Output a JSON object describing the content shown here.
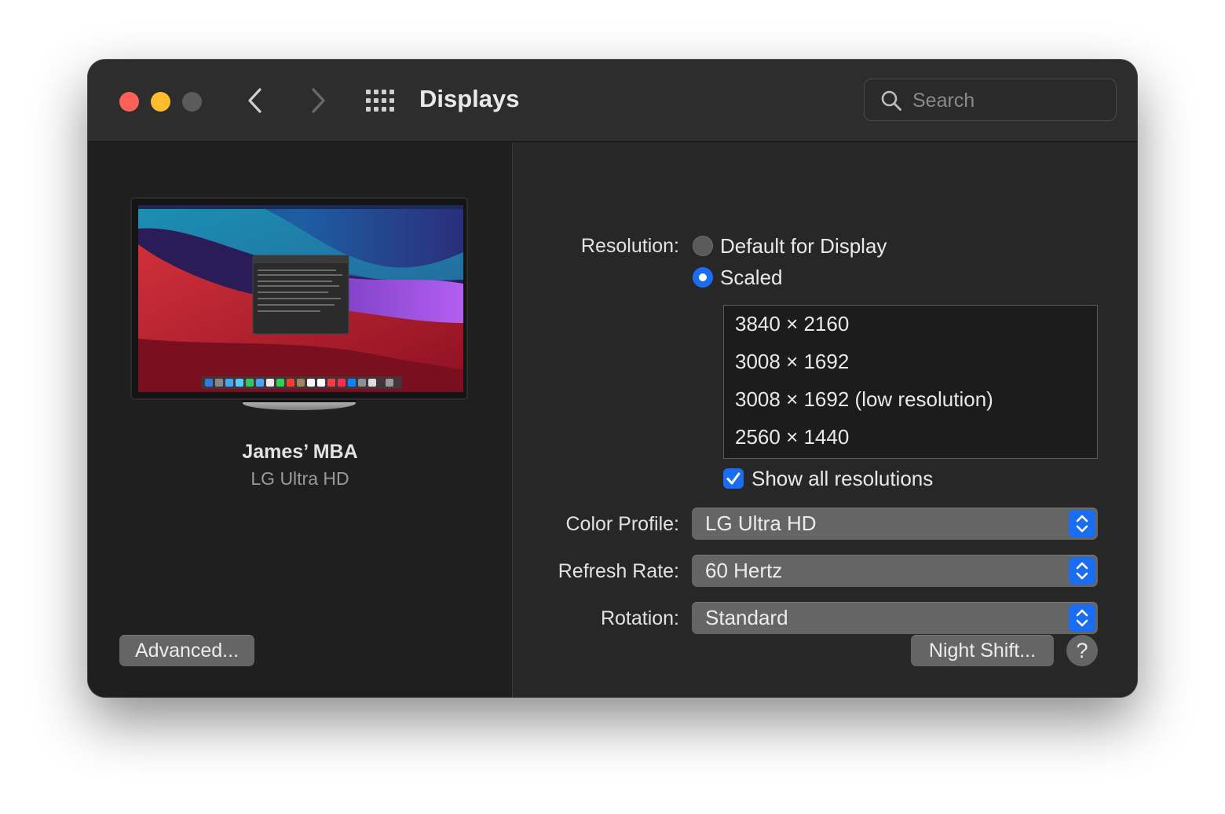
{
  "window": {
    "title": "Displays",
    "search_placeholder": "Search"
  },
  "device": {
    "name": "James’ MBA",
    "model": "LG Ultra HD"
  },
  "buttons": {
    "advanced": "Advanced...",
    "night_shift": "Night Shift...",
    "help": "?"
  },
  "resolution": {
    "label": "Resolution:",
    "options": [
      "Default for Display",
      "Scaled"
    ],
    "selected": "Scaled",
    "list": [
      "3840 × 2160",
      "3008 × 1692",
      "3008 × 1692 (low resolution)",
      "2560 × 1440"
    ],
    "show_all_label": "Show all resolutions",
    "show_all_checked": true
  },
  "color_profile": {
    "label": "Color Profile:",
    "value": "LG Ultra HD"
  },
  "refresh_rate": {
    "label": "Refresh Rate:",
    "value": "60 Hertz"
  },
  "rotation": {
    "label": "Rotation:",
    "value": "Standard"
  },
  "colors": {
    "accent": "#1a6cf0",
    "close": "#fe5f57",
    "minimize": "#febc2e",
    "zoom_disabled": "#5b5b5b"
  },
  "icons": {
    "back": "chevron-left-icon",
    "forward": "chevron-right-icon",
    "show_all": "grid-icon",
    "search": "search-icon",
    "popup": "up-down-chevron-icon",
    "check": "checkmark-icon"
  }
}
